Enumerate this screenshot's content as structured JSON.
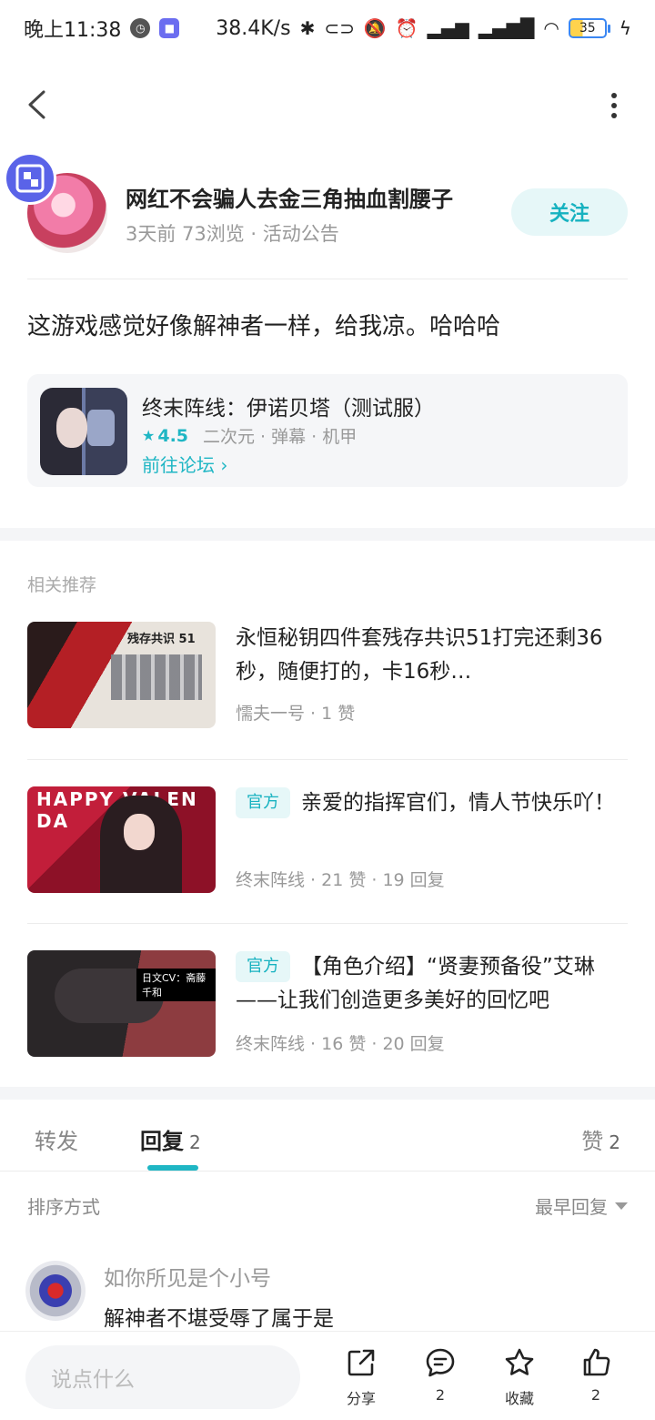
{
  "status_bar": {
    "time": "晚上11:38",
    "speed": "38.4K/s",
    "battery": "35"
  },
  "author": {
    "name": "网红不会骗人去金三角抽血割腰子",
    "meta": "3天前  73浏览  ·  活动公告",
    "follow_label": "关注"
  },
  "post": {
    "text": "这游戏感觉好像解神者一样，给我凉。哈哈哈"
  },
  "game_card": {
    "title": "终末阵线：伊诺贝塔（测试服）",
    "rating": "4.5",
    "tags": "二次元  ·  弹幕  ·  机甲",
    "link": "前往论坛"
  },
  "related": {
    "label": "相关推荐",
    "items": [
      {
        "tag": "",
        "title": "永恒秘钥四件套残存共识51打完还剩36秒，随便打的，卡16秒…",
        "meta": "懦夫一号  ·  1 赞",
        "thumb_text": "残存共识  51"
      },
      {
        "tag": "官方",
        "title": "亲爱的指挥官们，情人节快乐吖！",
        "meta": "终末阵线  ·  21 赞  ·  19 回复",
        "thumb_text": "HAPPY VALEN DA"
      },
      {
        "tag": "官方",
        "title": "【角色介绍】“贤妻预备役”艾琳——让我们创造更多美好的回忆吧",
        "meta": "终末阵线  ·  16 赞  ·  20 回复",
        "thumb_text": "日文CV：斋藤千和"
      }
    ]
  },
  "tabs": {
    "forward": "转发",
    "reply": "回复",
    "reply_count": "2",
    "like": "赞",
    "like_count": "2"
  },
  "sort": {
    "label": "排序方式",
    "value": "最早回复"
  },
  "comment": {
    "name": "如你所见是个小号",
    "text": "解神者不堪受辱了属于是"
  },
  "bottom_bar": {
    "input_placeholder": "说点什么",
    "share_label": "分享",
    "comment_count": "2",
    "favorite_label": "收藏",
    "like_count": "2"
  },
  "colors": {
    "accent": "#1fb6c4",
    "accent_bg": "#e6f7f8"
  }
}
